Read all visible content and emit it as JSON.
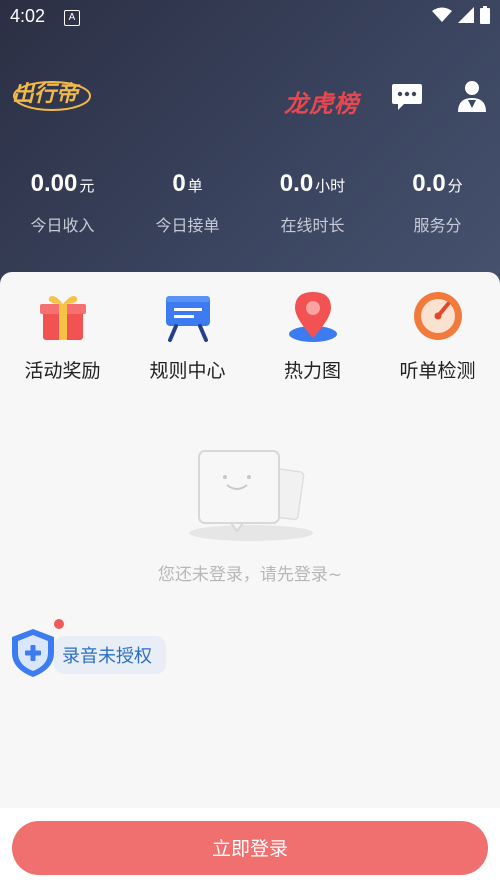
{
  "status_bar": {
    "time": "4:02",
    "app_badge": "A"
  },
  "header": {
    "logo_text": "出行帝",
    "ranking_label": "龙虎榜",
    "icons": {
      "message": "message-icon",
      "profile": "profile-icon"
    }
  },
  "stats": [
    {
      "value": "0.00",
      "unit": "元",
      "label": "今日收入"
    },
    {
      "value": "0",
      "unit": "单",
      "label": "今日接单"
    },
    {
      "value": "0.0",
      "unit": "小时",
      "label": "在线时长"
    },
    {
      "value": "0.0",
      "unit": "分",
      "label": "服务分"
    }
  ],
  "features": [
    {
      "label": "活动奖励",
      "icon": "gift-icon"
    },
    {
      "label": "规则中心",
      "icon": "easel-icon"
    },
    {
      "label": "热力图",
      "icon": "map-pin-icon"
    },
    {
      "label": "听单检测",
      "icon": "gauge-icon"
    }
  ],
  "empty_state": {
    "message": "您还未登录，请先登录~"
  },
  "recording_auth": {
    "label": "录音未授权"
  },
  "login_button": {
    "label": "立即登录"
  },
  "colors": {
    "accent": "#f07070",
    "header_bg": "#2f3650",
    "rank_red": "#e8474f"
  }
}
